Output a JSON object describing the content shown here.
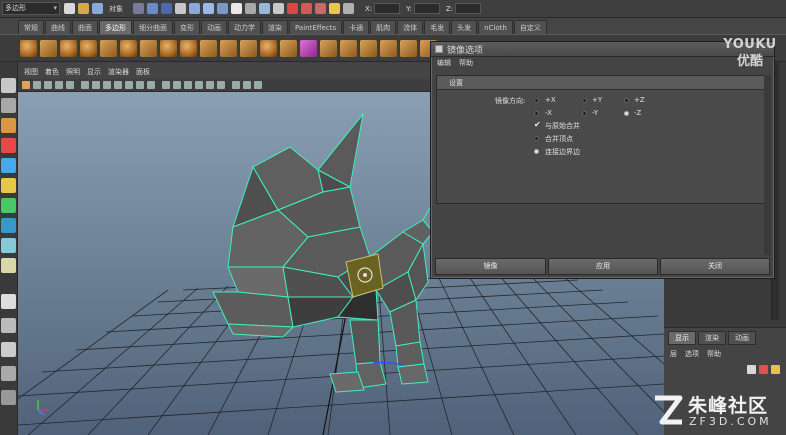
{
  "status_bar": {
    "mode_menu": "多边形",
    "object_label": "对象",
    "coords": [
      {
        "label": "X:"
      },
      {
        "label": "Y:"
      },
      {
        "label": "Z:"
      }
    ]
  },
  "shelf_tabs": [
    {
      "label": "常规"
    },
    {
      "label": "曲线"
    },
    {
      "label": "曲面"
    },
    {
      "label": "多边形",
      "active": true
    },
    {
      "label": "细分曲面"
    },
    {
      "label": "变形"
    },
    {
      "label": "动画"
    },
    {
      "label": "动力学"
    },
    {
      "label": "渲染"
    },
    {
      "label": "PaintEffects"
    },
    {
      "label": "卡通"
    },
    {
      "label": "肌肉"
    },
    {
      "label": "流体"
    },
    {
      "label": "毛发"
    },
    {
      "label": "头发"
    },
    {
      "label": "nCloth"
    },
    {
      "label": "自定义"
    }
  ],
  "panel_menu": [
    "视图",
    "着色",
    "照明",
    "显示",
    "渲染器",
    "面板"
  ],
  "dialog": {
    "title": "镜像选项",
    "menu": [
      "编辑",
      "帮助"
    ],
    "section": "设置",
    "mirror_direction_label": "镜像方向:",
    "directions": [
      {
        "label": "+X",
        "selected": false
      },
      {
        "label": "+Y",
        "selected": false
      },
      {
        "label": "+Z",
        "selected": false
      },
      {
        "label": "-X",
        "selected": false
      },
      {
        "label": "-Y",
        "selected": false
      },
      {
        "label": "-Z",
        "selected": true
      }
    ],
    "options": [
      {
        "label": "与原始合并",
        "kind": "check",
        "checked": true
      },
      {
        "label": "合并顶点",
        "kind": "radio",
        "selected": false
      },
      {
        "label": "连接边界边",
        "kind": "radio",
        "selected": true
      }
    ],
    "buttons": {
      "mirror": "镜像",
      "apply": "应用",
      "close": "关闭"
    }
  },
  "layer_panel": {
    "tabs": [
      {
        "label": "显示",
        "active": true
      },
      {
        "label": "渲染"
      },
      {
        "label": "动画"
      }
    ],
    "menu": [
      "层",
      "选项",
      "帮助"
    ]
  },
  "watermarks": {
    "youku_top": "YOUKU",
    "youku_bottom": "优酷",
    "zf_logo": "朱峰社区",
    "zf_url": "ZF3D.COM"
  },
  "colors": {
    "wireframe_highlight": "#3ef0c0",
    "viewport_sky": "#8a9fb3",
    "mesh_face": "#565656",
    "selected_face": "#6a6220"
  }
}
